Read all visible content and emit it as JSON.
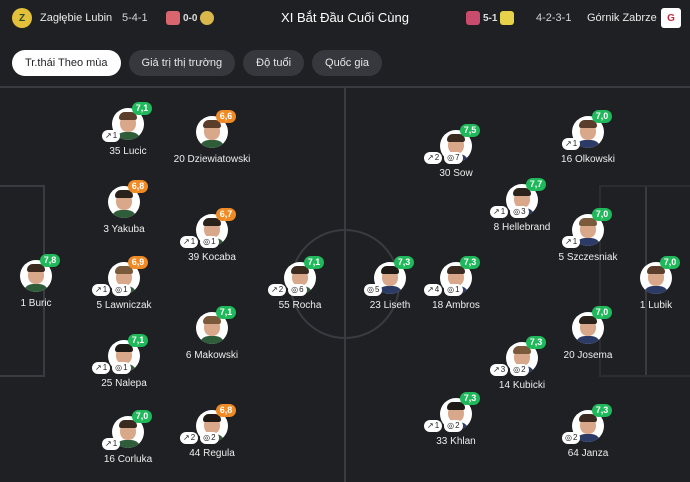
{
  "header": {
    "home_team": "Zagłębie Lubin",
    "home_formation": "5-4-1",
    "home_score": "0-0",
    "title": "XI Bắt Đầu Cuối Cùng",
    "away_score": "5-1",
    "away_formation": "4-2-3-1",
    "away_team": "Górnik Zabrze"
  },
  "tabs": [
    {
      "label": "Tr.thái Theo mùa",
      "active": true
    },
    {
      "label": "Giá trị thị trường",
      "active": false
    },
    {
      "label": "Độ tuổi",
      "active": false
    },
    {
      "label": "Quốc gia",
      "active": false
    }
  ],
  "colors": {
    "rating_green": "#1fb85a",
    "rating_orange": "#f08a24",
    "background": "#1f2024"
  },
  "home_players": [
    {
      "label": "1 Buric",
      "rating": "7,8",
      "rating_color": "green",
      "stats": []
    },
    {
      "label": "35 Lucic",
      "rating": "7,1",
      "rating_color": "green",
      "stats": [
        {
          "icon": "boot-icon",
          "value": "1"
        }
      ]
    },
    {
      "label": "3 Yakuba",
      "rating": "6,8",
      "rating_color": "orange",
      "stats": []
    },
    {
      "label": "5 Lawniczak",
      "rating": "6,9",
      "rating_color": "orange",
      "stats": [
        {
          "icon": "boot-icon",
          "value": "1"
        },
        {
          "icon": "ball-icon",
          "value": "1"
        }
      ]
    },
    {
      "label": "25 Nalepa",
      "rating": "7,1",
      "rating_color": "green",
      "stats": [
        {
          "icon": "boot-icon",
          "value": "1"
        },
        {
          "icon": "ball-icon",
          "value": "1"
        }
      ]
    },
    {
      "label": "16 Corluka",
      "rating": "7,0",
      "rating_color": "green",
      "stats": [
        {
          "icon": "boot-icon",
          "value": "1"
        }
      ]
    },
    {
      "label": "20 Dziewiatowski",
      "rating": "6,6",
      "rating_color": "orange",
      "stats": []
    },
    {
      "label": "39 Kocaba",
      "rating": "6,7",
      "rating_color": "orange",
      "stats": [
        {
          "icon": "boot-icon",
          "value": "1"
        },
        {
          "icon": "ball-icon",
          "value": "1"
        }
      ]
    },
    {
      "label": "6 Makowski",
      "rating": "7,1",
      "rating_color": "green",
      "stats": []
    },
    {
      "label": "44 Regula",
      "rating": "6,8",
      "rating_color": "orange",
      "stats": [
        {
          "icon": "boot-icon",
          "value": "2"
        },
        {
          "icon": "ball-icon",
          "value": "2"
        }
      ]
    },
    {
      "label": "55 Rocha",
      "rating": "7,1",
      "rating_color": "green",
      "stats": [
        {
          "icon": "boot-icon",
          "value": "2"
        },
        {
          "icon": "ball-icon",
          "value": "6"
        }
      ]
    }
  ],
  "away_players": [
    {
      "label": "30 Sow",
      "rating": "7,5",
      "rating_color": "green",
      "stats": [
        {
          "icon": "boot-icon",
          "value": "2"
        },
        {
          "icon": "ball-icon",
          "value": "7"
        }
      ]
    },
    {
      "label": "16 Olkowski",
      "rating": "7,0",
      "rating_color": "green",
      "stats": [
        {
          "icon": "boot-icon",
          "value": "1"
        }
      ]
    },
    {
      "label": "8 Hellebrand",
      "rating": "7,7",
      "rating_color": "green",
      "stats": [
        {
          "icon": "boot-icon",
          "value": "1"
        },
        {
          "icon": "ball-icon",
          "value": "3"
        }
      ]
    },
    {
      "label": "5 Szczesniak",
      "rating": "7,0",
      "rating_color": "green",
      "stats": [
        {
          "icon": "boot-icon",
          "value": "1"
        }
      ]
    },
    {
      "label": "23 Liseth",
      "rating": "7,3",
      "rating_color": "green",
      "stats": [
        {
          "icon": "ball-icon",
          "value": "5"
        }
      ]
    },
    {
      "label": "18 Ambros",
      "rating": "7,3",
      "rating_color": "green",
      "stats": [
        {
          "icon": "boot-icon",
          "value": "4"
        },
        {
          "icon": "ball-icon",
          "value": "1"
        }
      ]
    },
    {
      "label": "1 Lubik",
      "rating": "7,0",
      "rating_color": "green",
      "stats": []
    },
    {
      "label": "20 Josema",
      "rating": "7,0",
      "rating_color": "green",
      "stats": []
    },
    {
      "label": "14 Kubicki",
      "rating": "7,3",
      "rating_color": "green",
      "stats": [
        {
          "icon": "boot-icon",
          "value": "3"
        },
        {
          "icon": "ball-icon",
          "value": "2"
        }
      ]
    },
    {
      "label": "33 Khlan",
      "rating": "7,3",
      "rating_color": "green",
      "stats": [
        {
          "icon": "boot-icon",
          "value": "1"
        },
        {
          "icon": "ball-icon",
          "value": "2"
        }
      ]
    },
    {
      "label": "64 Janza",
      "rating": "7,3",
      "rating_color": "green",
      "stats": [
        {
          "icon": "ball-icon",
          "value": "2"
        }
      ]
    }
  ]
}
